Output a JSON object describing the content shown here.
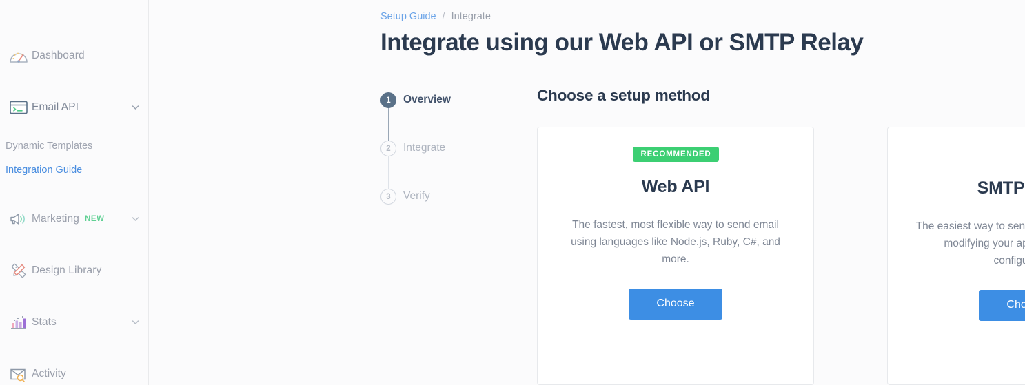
{
  "colors": {
    "accent_blue": "#3d8ee4",
    "badge_green": "#3ccf73",
    "new_green": "#5fd093",
    "link_blue": "#4a8ee0",
    "title_navy": "#2b3a4f",
    "page_bg": "#fbfbfc"
  },
  "sidebar": {
    "items": [
      {
        "label": "Dashboard",
        "icon": "speedometer-icon",
        "chevron": false
      },
      {
        "label": "Email API",
        "icon": "terminal-window-icon",
        "chevron": true
      },
      {
        "label": "Marketing",
        "icon": "megaphone-icon",
        "chevron": true,
        "badge": "NEW"
      },
      {
        "label": "Design Library",
        "icon": "ruler-pencil-icon",
        "chevron": false
      },
      {
        "label": "Stats",
        "icon": "bar-chart-icon",
        "chevron": true
      },
      {
        "label": "Activity",
        "icon": "envelope-search-icon",
        "chevron": false
      }
    ],
    "sub_items": [
      {
        "label": "Dynamic Templates",
        "active": false
      },
      {
        "label": "Integration Guide",
        "active": true
      }
    ]
  },
  "breadcrumb": {
    "root": "Setup Guide",
    "separator": "/",
    "current": "Integrate"
  },
  "page": {
    "title": "Integrate using our Web API or SMTP Relay",
    "section_title": "Choose a setup method"
  },
  "stepper": {
    "steps": [
      {
        "number": "1",
        "label": "Overview",
        "state": "active"
      },
      {
        "number": "2",
        "label": "Integrate",
        "state": "upcoming"
      },
      {
        "number": "3",
        "label": "Verify",
        "state": "upcoming"
      }
    ]
  },
  "cards": [
    {
      "badge": "RECOMMENDED",
      "title": "Web API",
      "description": "The fastest, most flexible way to send email using languages like Node.js, Ruby, C#, and more.",
      "button": "Choose"
    },
    {
      "badge": "",
      "title": "SMTP Relay",
      "description": "The easiest way to send email. It only requires modifying your application's SMTP configuration.",
      "button": "Choose"
    }
  ]
}
